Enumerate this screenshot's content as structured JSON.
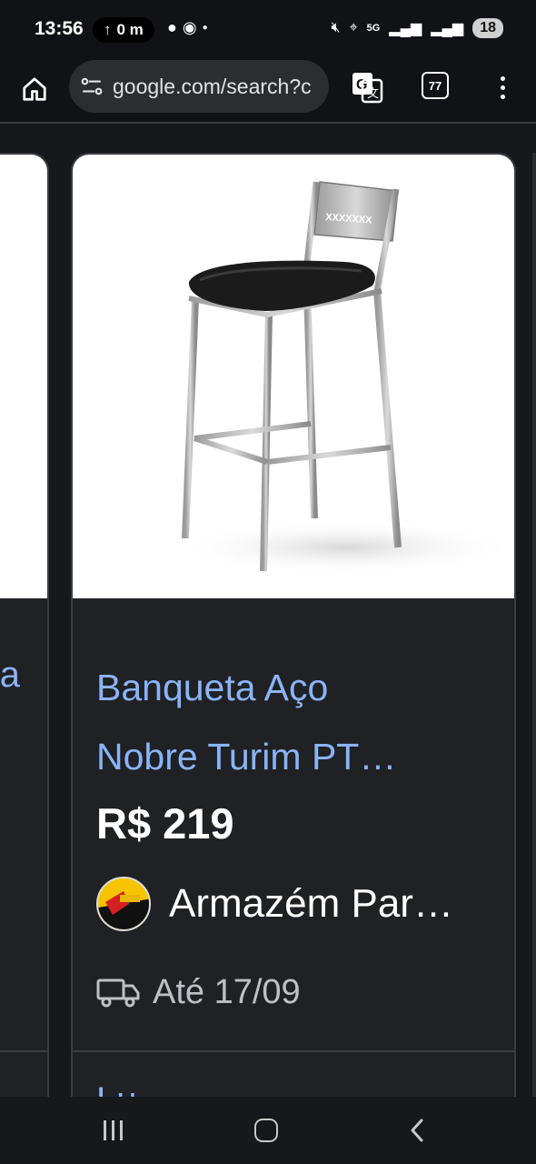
{
  "status_bar": {
    "time": "13:56",
    "upload_pill": "0 m",
    "battery": "18",
    "network": "5G"
  },
  "browser": {
    "url": "google.com/search?c",
    "tab_count": "77",
    "icons": [
      "home-icon",
      "site-settings-icon",
      "translate-icon",
      "tabs-icon",
      "more-vert-icon"
    ]
  },
  "left_card": {
    "cut_text": "a"
  },
  "product": {
    "title_line1": "Banqueta Aço",
    "title_line2": "Nobre Turim PT…",
    "price": "R$ 219",
    "store_name": "Armazém Par…",
    "delivery": "Até 17/09",
    "next_peek": "Lu"
  },
  "colors": {
    "link": "#8ab4f8",
    "background": "#17181c",
    "card": "#202124"
  }
}
